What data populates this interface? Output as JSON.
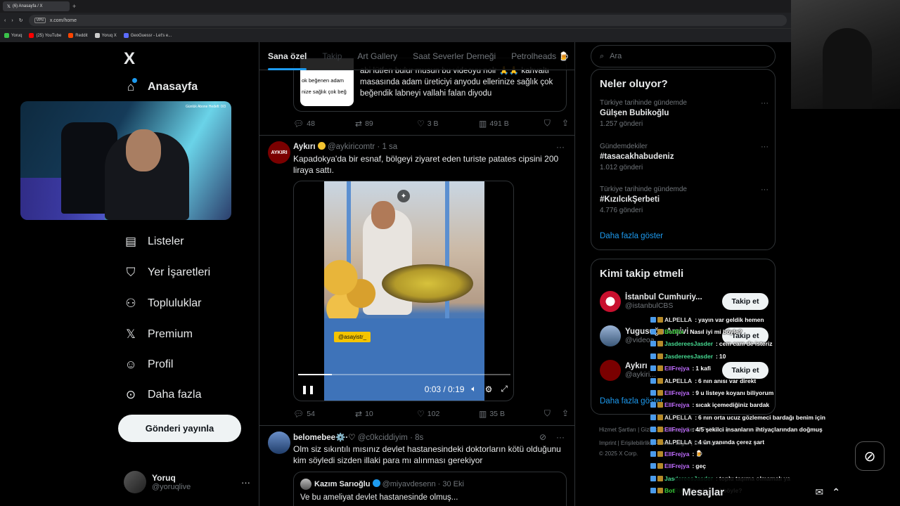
{
  "browser": {
    "tab_title": "(6) Anasayfa / X",
    "new_tab": "+",
    "url": "x.com/home",
    "vpn": "VPN",
    "bookmarks": [
      {
        "label": "Yoruq",
        "color": "#3ac24a"
      },
      {
        "label": "(25) YouTube",
        "color": "#ff0000"
      },
      {
        "label": "Reddit",
        "color": "#ff4500"
      },
      {
        "label": "Yoruq X",
        "color": "#cccccc"
      },
      {
        "label": "GeoGuessr - Let's e...",
        "color": "#5b6cff"
      }
    ]
  },
  "nav": {
    "logo": "X",
    "home": "Anasayfa",
    "lists": "Listeler",
    "bookmarks": "Yer İşaretleri",
    "communities": "Topluluklar",
    "premium": "Premium",
    "profile": "Profil",
    "more": "Daha fazla",
    "post_button": "Gönderi yayınla",
    "webcam_caption": "Günlük Abone Hedefi: 0/3"
  },
  "account": {
    "name": "Yoruq",
    "handle": "@yoruqlive",
    "more": "···"
  },
  "tabs": [
    "Sana özel",
    "Takip",
    "Art Gallery",
    "Saat Severler Derneği",
    "Petrolheads 🍺"
  ],
  "feed": {
    "quote1": {
      "thumb_lines": [
        "ok beğenen adam",
        "nize sağlık çok beğ"
      ],
      "text": "abi lütfen bulur musun bu videoyu nolr 🙏🙏 kahvaltı masasında adam üreticiyi anyodu ellerinize sağlık çok beğendik labneyi vallahi falan diyodu"
    },
    "actions1": {
      "replies": "48",
      "reposts": "89",
      "likes": "3 B",
      "views": "491 B"
    },
    "tweet2": {
      "avatar_text": "AYKIRI",
      "name": "Aykırı",
      "handle": "@aykiricomtr",
      "time": "· 1 sa",
      "text": "Kapadokya'da bir esnaf, bölgeyi ziyaret eden turiste patates cipsini 200 liraya sattı.",
      "video": {
        "sticker": "@asayistr_",
        "time": "0:03 / 0:19",
        "progress": 0.16
      }
    },
    "actions2": {
      "replies": "54",
      "reposts": "10",
      "likes": "102",
      "views": "35 B"
    },
    "tweet3": {
      "name": "belomebee⚙️·♡",
      "handle": "@c0kciddiyim",
      "time": "· 8s",
      "text": "Olm siz sıkıntılı mısınız devlet hastanesindeki doktorların kötü olduğunu kim söyledi sizden illaki para mı alınması gerekiyor",
      "quote": {
        "name": "Kazım Sarıoğlu",
        "handle": "@miyavdesenn",
        "time": "· 30 Eki",
        "text": "Ve bu ameliyat devlet hastanesinde olmuş..."
      }
    }
  },
  "sidebar": {
    "search_placeholder": "Ara",
    "trends_title": "Neler oluyor?",
    "trends": [
      {
        "context": "Türkiye tarihinde gündemde",
        "name": "Gülşen Bubikoğlu",
        "count": "1.257 gönderi"
      },
      {
        "context": "Gündemdekiler",
        "name": "#tasacakhabudeniz",
        "count": "1.012 gönderi"
      },
      {
        "context": "Türkiye tarihinde gündemde",
        "name": "#KızılcıkŞerbeti",
        "count": "4.776 gönderi"
      }
    ],
    "show_more": "Daha fazla göster",
    "who_title": "Kimi takip etmeli",
    "who": [
      {
        "name": "İstanbul Cumhuriy...",
        "handle": "@istanbulCBS",
        "follow": "Takip et"
      },
      {
        "name": "Yugusuğu Arşivi",
        "handle": "@videoa...",
        "follow": "Takip et"
      },
      {
        "name": "Aykırı",
        "handle": "@aykiri...",
        "follow": "Takip et"
      }
    ],
    "who_show_more": "Daha fazla göster",
    "footer1": "Hizmet Şartları  |  Gizlilik Politikası  |  Çerez Politikası  |",
    "footer2": "Imprint  |  Erişilebilirlik  |  Reklam bilgisi  |  Daha fazla ···",
    "footer3": "© 2025 X Corp."
  },
  "chat": [
    {
      "user": "ALPELLA",
      "color": "#e0e0e0",
      "msg": "yayın var geldik hemen"
    },
    {
      "user": "BotRix",
      "color": "#3ad13a",
      "msg": "Nasıl iyi mi böyle?"
    },
    {
      "user": "JasdereesJasder",
      "color": "#45d890",
      "msg": "cem cam de isteriz"
    },
    {
      "user": "JasdereesJasder",
      "color": "#45d890",
      "msg": "10"
    },
    {
      "user": "EllFrejya",
      "color": "#c06cff",
      "msg": "1 kafi"
    },
    {
      "user": "ALPELLA",
      "color": "#e0e0e0",
      "msg": "6 nın anısı var direkt"
    },
    {
      "user": "EllFrejya",
      "color": "#c06cff",
      "msg": "9 u listeye koyanı biliyorum"
    },
    {
      "user": "EllFrejya",
      "color": "#c06cff",
      "msg": "sıcak içemediğiniz bardak"
    },
    {
      "user": "ALPELLA",
      "color": "#e0e0e0",
      "msg": "6 nın orta ucuz gözlemeci bardağı benim için"
    },
    {
      "user": "EllFrejya",
      "color": "#c06cff",
      "msg": "4/5 şekilci insanların ihtiyaçlarından doğmuş"
    },
    {
      "user": "ALPELLA",
      "color": "#e0e0e0",
      "msg": "4 ün yanında çerez şart"
    },
    {
      "user": "EllFrejya",
      "color": "#c06cff",
      "msg": "🍺"
    },
    {
      "user": "EllFrejya",
      "color": "#c06cff",
      "msg": "geç"
    },
    {
      "user": "JasdereesJasder",
      "color": "#45d890",
      "msg": "toplu taşıma olmamalı ya"
    },
    {
      "user": "BotRix",
      "color": "#3ad13a",
      "msg": "Nasıl iyi mi böyle?"
    }
  ],
  "messages": {
    "label": "Mesajlar"
  }
}
